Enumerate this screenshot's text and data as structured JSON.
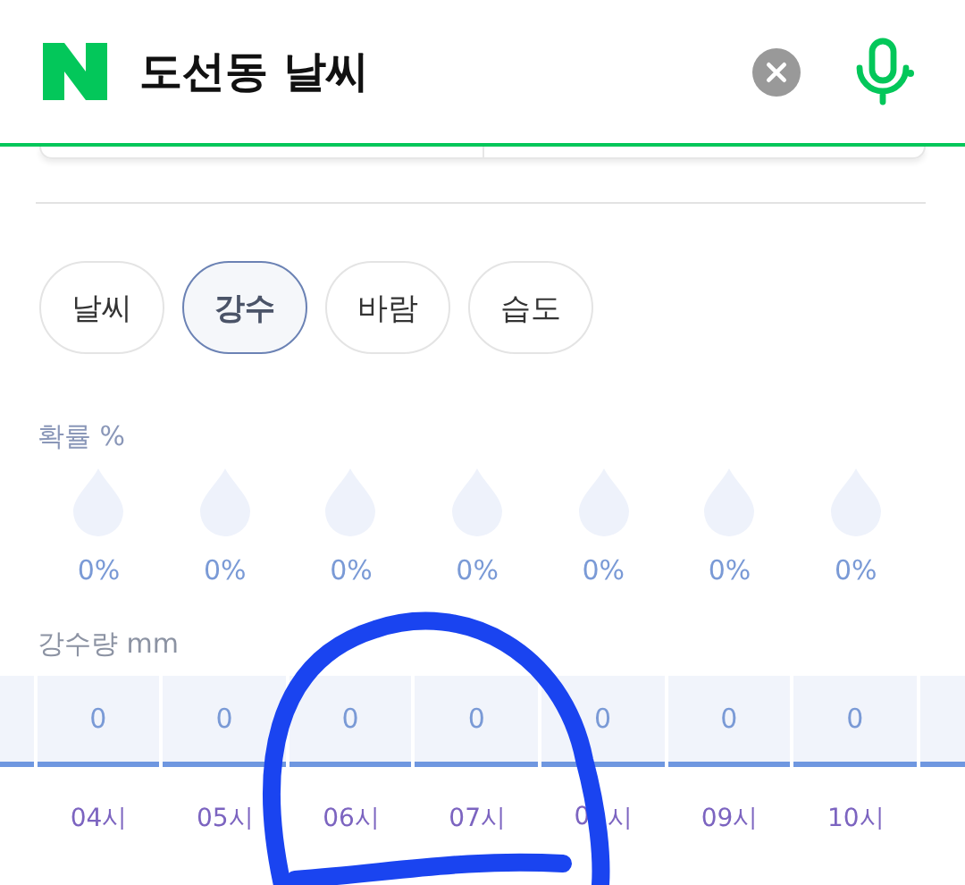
{
  "search": {
    "value": "도선동 날씨"
  },
  "tabs": [
    {
      "label": "날씨",
      "selected": false
    },
    {
      "label": "강수",
      "selected": true
    },
    {
      "label": "바람",
      "selected": false
    },
    {
      "label": "습도",
      "selected": false
    }
  ],
  "probability": {
    "label": "확률 %",
    "items": [
      "0%",
      "0%",
      "0%",
      "0%",
      "0%",
      "0%",
      "0%"
    ]
  },
  "amount": {
    "label": "강수량 mm",
    "values": [
      "0",
      "0",
      "0",
      "0",
      "0",
      "0",
      "0"
    ],
    "hours": [
      "04시",
      "05시",
      "06시",
      "07시",
      {
        "parts": [
          "0",
          "시"
        ]
      },
      "09시",
      "10시"
    ]
  }
}
